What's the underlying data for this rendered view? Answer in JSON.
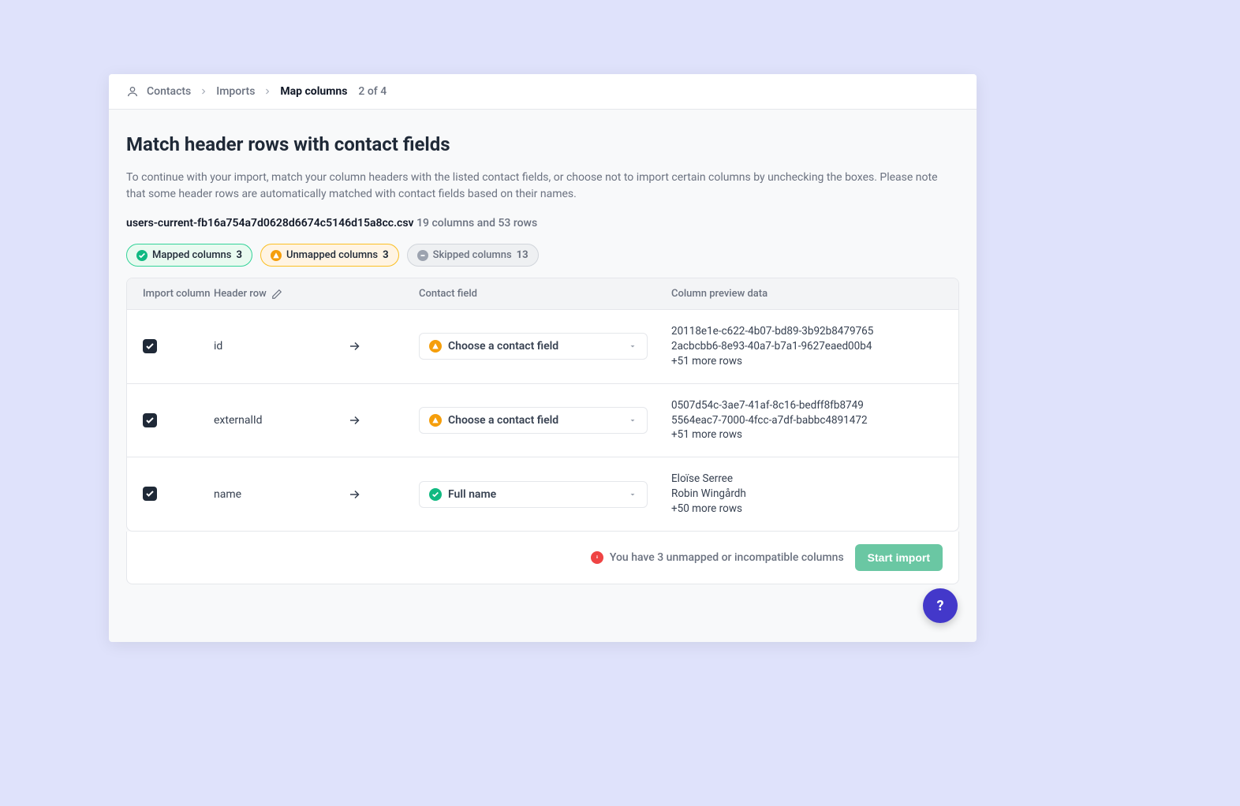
{
  "breadcrumb": {
    "contacts": "Contacts",
    "imports": "Imports",
    "current": "Map columns",
    "step": "2 of 4"
  },
  "page": {
    "title": "Match header rows with contact fields",
    "description": "To continue with your import, match your column headers with the listed contact fields, or choose not to import certain columns by unchecking the boxes. Please note that some header rows are automatically matched with contact fields based on their names."
  },
  "file": {
    "name": "users-current-fb16a754a7d0628d6674c5146d15a8cc.csv",
    "meta": "19 columns and 53 rows"
  },
  "chips": {
    "mapped": {
      "label": "Mapped columns",
      "count": "3"
    },
    "unmapped": {
      "label": "Unmapped columns",
      "count": "3"
    },
    "skipped": {
      "label": "Skipped columns",
      "count": "13"
    }
  },
  "table": {
    "headers": {
      "import_column": "Import column",
      "header_row": "Header row",
      "contact_field": "Contact field",
      "preview": "Column preview data"
    },
    "rows": [
      {
        "header": "id",
        "field_label": "Choose a contact field",
        "mapped": false,
        "preview1": "20118e1e-c622-4b07-bd89-3b92b8479765",
        "preview2": "2acbcbb6-8e93-40a7-b7a1-9627eaed00b4",
        "more": "+51 more rows"
      },
      {
        "header": "externalId",
        "field_label": "Choose a contact field",
        "mapped": false,
        "preview1": "0507d54c-3ae7-41af-8c16-bedff8fb8749",
        "preview2": "5564eac7-7000-4fcc-a7df-babbc4891472",
        "more": "+51 more rows"
      },
      {
        "header": "name",
        "field_label": "Full name",
        "mapped": true,
        "preview1": "Eloïse Serree",
        "preview2": "Robin Wingårdh",
        "more": "+50 more rows"
      }
    ]
  },
  "footer": {
    "warning": "You have 3 unmapped or incompatible columns",
    "start": "Start import"
  },
  "help": "?"
}
